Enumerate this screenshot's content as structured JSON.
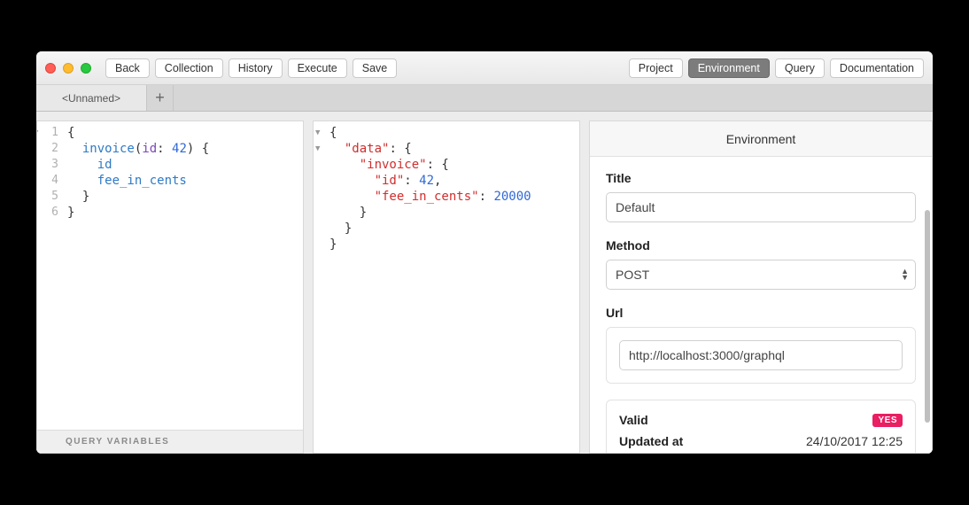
{
  "toolbar": {
    "left": {
      "back": "Back",
      "collection": "Collection",
      "history": "History",
      "execute": "Execute",
      "save": "Save"
    },
    "right": {
      "project": "Project",
      "environment": "Environment",
      "query": "Query",
      "documentation": "Documentation"
    }
  },
  "tabs": {
    "active": "<Unnamed>",
    "add": "+"
  },
  "query_editor": {
    "lines": [
      "1",
      "2",
      "3",
      "4",
      "5",
      "6"
    ],
    "code_html": "{\n  <span class=\"tok-field\">invoice</span>(<span class=\"tok-param\">id</span>: <span class=\"tok-num\">42</span>) {\n    <span class=\"tok-field\">id</span>\n    <span class=\"tok-field\">fee_in_cents</span>\n  }\n}"
  },
  "query_variables_label": "QUERY VARIABLES",
  "response": {
    "code_html": "{\n  <span class=\"tok-key\">\"data\"</span>: {\n    <span class=\"tok-key\">\"invoice\"</span>: {\n      <span class=\"tok-key\">\"id\"</span>: <span class=\"tok-num\">42</span>,\n      <span class=\"tok-key\">\"fee_in_cents\"</span>: <span class=\"tok-num\">20000</span>\n    }\n  }\n}"
  },
  "environment": {
    "header": "Environment",
    "title_label": "Title",
    "title_value": "Default",
    "method_label": "Method",
    "method_value": "POST",
    "url_label": "Url",
    "url_value": "http://localhost:3000/graphql",
    "valid_label": "Valid",
    "valid_badge": "YES",
    "updated_label": "Updated at",
    "updated_value": "24/10/2017 12:25"
  }
}
